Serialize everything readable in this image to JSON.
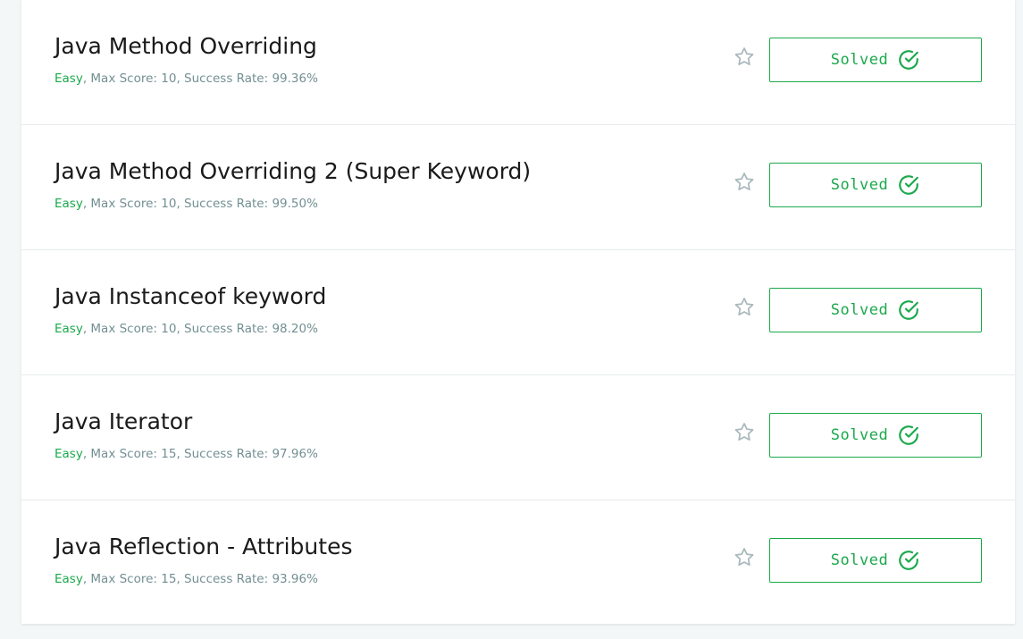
{
  "colors": {
    "accent_green": "#1ba94c",
    "meta_gray": "#738f93",
    "star_gray": "#a9b8bb"
  },
  "challenges": [
    {
      "title": "Java Method Overriding",
      "difficulty": "Easy",
      "details": ", Max Score: 10, Success Rate: 99.36%",
      "status": "Solved",
      "star_icon": "star-outline-icon",
      "status_icon": "check-circle-icon"
    },
    {
      "title": "Java Method Overriding 2 (Super Keyword)",
      "difficulty": "Easy",
      "details": ", Max Score: 10, Success Rate: 99.50%",
      "status": "Solved",
      "star_icon": "star-outline-icon",
      "status_icon": "check-circle-icon"
    },
    {
      "title": "Java Instanceof keyword",
      "difficulty": "Easy",
      "details": ", Max Score: 10, Success Rate: 98.20%",
      "status": "Solved",
      "star_icon": "star-outline-icon",
      "status_icon": "check-circle-icon"
    },
    {
      "title": "Java Iterator",
      "difficulty": "Easy",
      "details": ", Max Score: 15, Success Rate: 97.96%",
      "status": "Solved",
      "star_icon": "star-outline-icon",
      "status_icon": "check-circle-icon"
    },
    {
      "title": "Java Reflection - Attributes",
      "difficulty": "Easy",
      "details": ", Max Score: 15, Success Rate: 93.96%",
      "status": "Solved",
      "star_icon": "star-outline-icon",
      "status_icon": "check-circle-icon"
    }
  ]
}
